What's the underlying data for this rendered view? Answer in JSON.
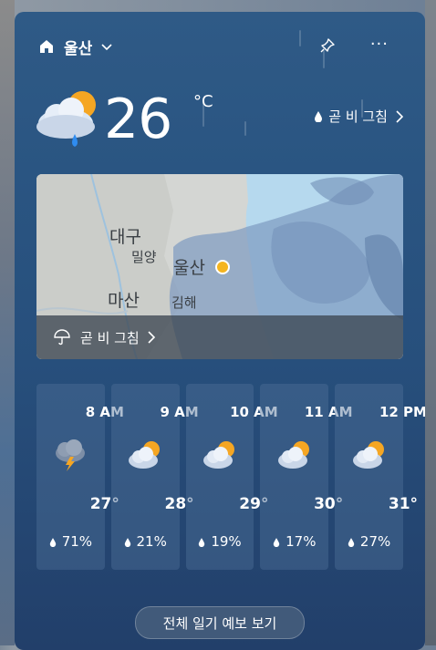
{
  "header": {
    "location": "울산",
    "icons": {
      "home": "home-icon",
      "dropdown": "chevron-down-icon",
      "pin": "pin-icon",
      "more": "more-icon"
    }
  },
  "current": {
    "temperature": "26",
    "unit": "°C",
    "condition_icon": "partly-sunny-rain-icon",
    "rain_notice": "곧 비 그침"
  },
  "map": {
    "labels": [
      "대구",
      "밀양",
      "울산",
      "마산",
      "김해"
    ],
    "bar_label": "곧 비 그침"
  },
  "hourly": [
    {
      "time": "8 AM",
      "temp": "27°",
      "precip": "71%",
      "icon": "thunderstorm-icon"
    },
    {
      "time": "9 AM",
      "temp": "28°",
      "precip": "21%",
      "icon": "partly-sunny-icon"
    },
    {
      "time": "10 AM",
      "temp": "29°",
      "precip": "19%",
      "icon": "partly-sunny-icon"
    },
    {
      "time": "11 AM",
      "temp": "30°",
      "precip": "17%",
      "icon": "partly-sunny-icon"
    },
    {
      "time": "12 PM",
      "temp": "31°",
      "precip": "27%",
      "icon": "partly-sunny-icon"
    }
  ],
  "footer": {
    "full_forecast_button": "전체 일기 예보 보기"
  },
  "colors": {
    "card_top": "#2f5a86",
    "card_bottom": "#223f6a",
    "sun": "#f5a623",
    "accent_dot": "#f5b520"
  }
}
